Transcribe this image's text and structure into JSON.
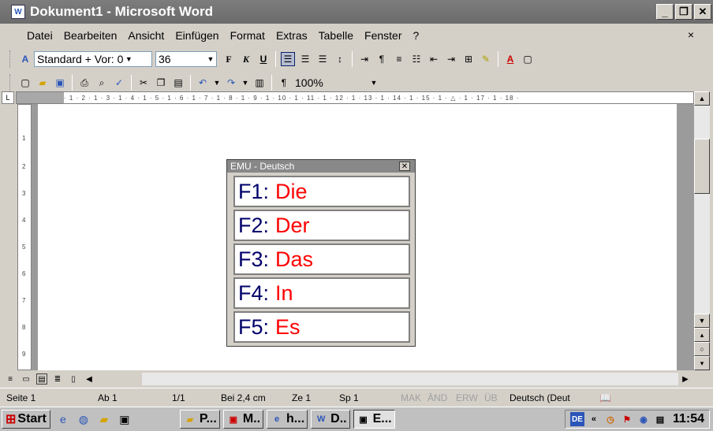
{
  "window": {
    "title": "Dokument1 - Microsoft Word",
    "app_icon": "W"
  },
  "menu": {
    "items": [
      "Datei",
      "Bearbeiten",
      "Ansicht",
      "Einfügen",
      "Format",
      "Extras",
      "Tabelle",
      "Fenster",
      "?"
    ],
    "close": "×"
  },
  "format_toolbar": {
    "style_value": "Standard + Vor: 0",
    "font_size": "36",
    "bold": "F",
    "italic": "K",
    "underline": "U"
  },
  "standard_toolbar": {
    "zoom": "100%",
    "para_mark": "¶"
  },
  "ruler_text": "· 1 · 2 · 1 · 3 · 1 · 4 · 1 · 5 · 1 · 6 · 1 · 7 · 1 · 8 · 1 · 9 · 1 · 10 · 1 · 11 · 1 · 12 · 1 · 13 · 1 · 14 · 1 · 15 · 1 · △ · 1 · 17 · 1 · 18 ·",
  "vertical_ruler": [
    "1",
    "2",
    "3",
    "4",
    "5",
    "6",
    "7",
    "8",
    "9"
  ],
  "emu_window": {
    "title": "EMU - Deutsch",
    "items": [
      {
        "key": "F1:",
        "word": "Die"
      },
      {
        "key": "F2:",
        "word": "Der"
      },
      {
        "key": "F3:",
        "word": "Das"
      },
      {
        "key": "F4:",
        "word": "In"
      },
      {
        "key": "F5:",
        "word": "Es"
      }
    ]
  },
  "status": {
    "seite": "Seite 1",
    "ab": "Ab 1",
    "pages": "1/1",
    "bei": "Bei 2,4 cm",
    "ze": "Ze 1",
    "sp": "Sp 1",
    "mak": "MAK",
    "and": "ÄND",
    "erw": "ERW",
    "ub": "ÜB",
    "lang": "Deutsch (Deut"
  },
  "taskbar": {
    "start": "Start",
    "buttons": [
      "P...",
      "M..",
      "h...",
      "D..",
      "E..."
    ],
    "lang": "DE",
    "time": "11:54"
  },
  "colors": {
    "key_text": "#00006b",
    "word_text": "#ff0000",
    "titlebar": "#7a7a7a"
  }
}
